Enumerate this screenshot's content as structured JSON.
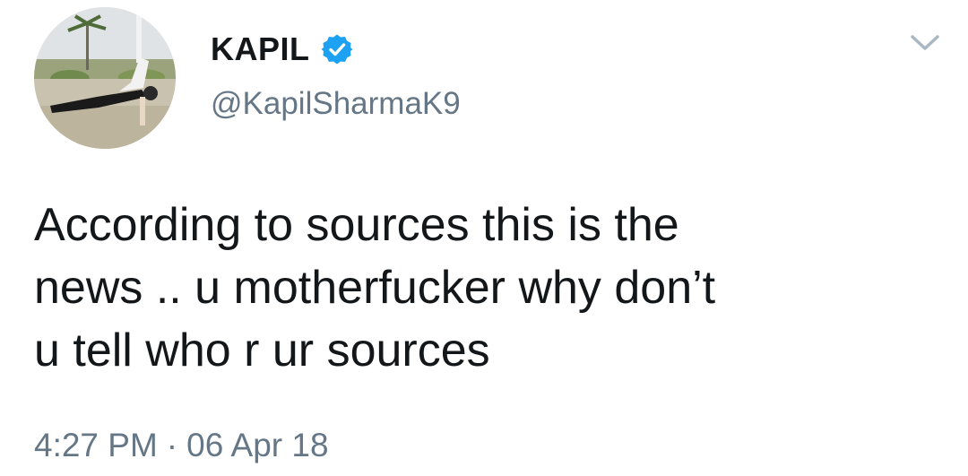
{
  "tweet": {
    "author": {
      "display_name": "KAPIL",
      "handle": "@KapilSharmaK9",
      "verified": true,
      "avatar_icon": "profile-photo-avatar"
    },
    "text": "According to sources this is the\nnews .. u motherfucker why don’t\nu tell who r ur sources",
    "time": "4:27 PM",
    "separator": "·",
    "date": "06 Apr 18",
    "menu_icon": "chevron-down-icon"
  },
  "colors": {
    "text": "#14171a",
    "secondary": "#657786",
    "verified_blue": "#1da1f2",
    "background": "#ffffff"
  }
}
